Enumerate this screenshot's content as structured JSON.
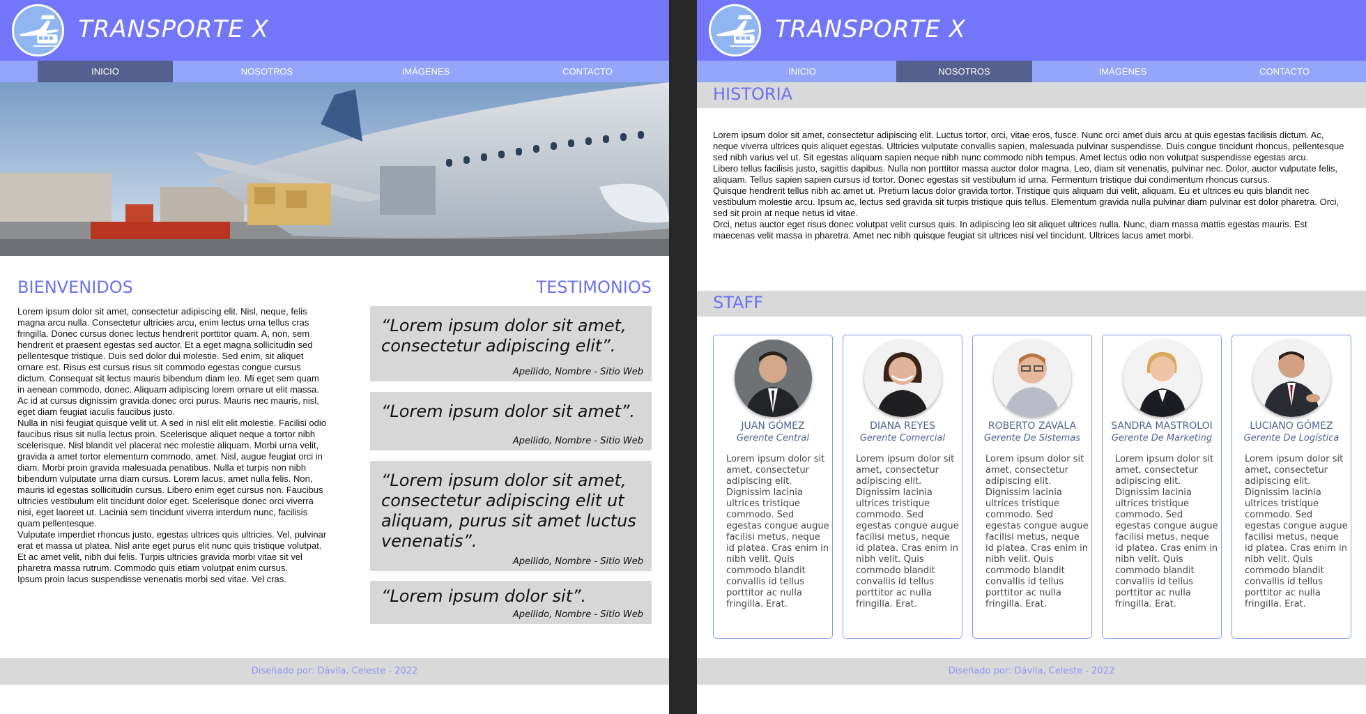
{
  "site": {
    "brand": "TRANSPORTE X"
  },
  "nav": {
    "items": [
      "INICIO",
      "NOSOTROS",
      "IMÁGENES",
      "CONTACTO"
    ]
  },
  "home": {
    "welcome_title": "BIENVENIDOS",
    "welcome_text": "Lorem ipsum dolor sit amet, consectetur adipiscing elit. Nisl, neque, felis magna arcu nulla. Consectetur ultricies arcu, enim lectus urna tellus cras fringilla. Donec cursus donec lectus hendrerit porttitor quam. A, non, sem hendrerit et praesent egestas sed auctor. Et a eget magna sollicitudin sed pellentesque tristique. Duis sed dolor dui molestie. Sed enim, sit aliquet ornare est. Risus est cursus risus sit commodo egestas congue cursus dictum. Consequat sit lectus mauris bibendum diam leo. Mi eget sem quam in aenean commodo, donec. Aliquam adipiscing lorem ornare ut elit massa. Ac id at cursus dignissim gravida donec orci purus. Mauris nec mauris, nisl, eget diam feugiat iaculis faucibus justo.\nNulla in nisi feugiat quisque velit ut. A sed in nisl elit elit molestie. Facilisi odio faucibus risus sit nulla lectus proin. Scelerisque aliquet neque a tortor nibh scelerisque. Nisl blandit vel placerat nec molestie aliquam. Morbi urna velit, gravida a amet tortor elementum commodo, amet. Nisl, augue feugiat orci in diam. Morbi proin gravida malesuada penatibus. Nulla et turpis non nibh bibendum vulputate urna diam cursus. Lorem lacus, amet nulla felis. Non, mauris id egestas sollicitudin cursus. Libero enim eget cursus non. Faucibus ultricies vestibulum elit tincidunt dolor eget. Scelerisque donec orci viverra nisi, eget laoreet ut. Lacinia sem tincidunt viverra interdum nunc, facilisis quam pellentesque.\nVulputate imperdiet rhoncus justo, egestas ultrices quis ultricies. Vel, pulvinar erat et massa ut platea. Nisl ante eget purus elit nunc quis tristique volutpat. Et ac amet velit, nibh dui felis. Turpis ultricies gravida morbi vitae sit vel pharetra massa rutrum. Commodo quis etiam volutpat enim cursus.\nIpsum proin lacus suspendisse venenatis morbi sed vitae. Vel cras.",
    "testimonials_title": "TESTIMONIOS",
    "testimonials": [
      {
        "quote": "“Lorem ipsum dolor sit amet, consectetur adipiscing elit”.",
        "author": "Apellido, Nombre - Sitio Web"
      },
      {
        "quote": "“Lorem ipsum dolor sit amet”.",
        "author": "Apellido, Nombre - Sitio Web"
      },
      {
        "quote": "“Lorem ipsum dolor sit amet, consectetur adipiscing elit ut aliquam, purus sit amet luctus venenatis”.",
        "author": "Apellido, Nombre - Sitio Web"
      },
      {
        "quote": "“Lorem ipsum dolor sit”.",
        "author": "Apellido, Nombre - Sitio Web"
      }
    ]
  },
  "about": {
    "history_title": "HISTORIA",
    "history_text": "Lorem ipsum dolor sit amet, consectetur adipiscing elit. Luctus tortor, orci, vitae eros, fusce. Nunc orci amet duis arcu at quis egestas facilisis dictum. Ac, neque viverra ultrices quis aliquet egestas. Ultricies vulputate convallis sapien, malesuada pulvinar suspendisse. Duis congue tincidunt rhoncus, pellentesque sed nibh varius vel ut. Sit egestas aliquam sapien neque nibh nunc commodo nibh tempus. Amet lectus odio non volutpat suspendisse egestas arcu.\nLibero tellus facilisis justo, sagittis dapibus. Nulla non porttitor massa auctor dolor magna. Leo, diam sit venenatis, pulvinar nec. Dolor, auctor vulputate felis, aliquam. Tellus sapien sapien cursus id tortor. Donec egestas sit vestibulum id urna. Fermentum tristique dui condimentum rhoncus cursus.\nQuisque hendrerit tellus nibh ac amet ut. Pretium lacus dolor gravida tortor. Tristique quis aliquam dui velit, aliquam. Eu et ultrices eu quis blandit nec vestibulum molestie arcu. Ipsum ac, lectus sed gravida sit turpis tristique quis tellus. Elementum gravida nulla pulvinar diam pulvinar est dolor pharetra. Orci, sed sit proin at neque netus id vitae.\nOrci, netus auctor eget risus donec volutpat velit cursus quis. In adipiscing leo sit aliquet ultrices nulla. Nunc, diam massa mattis egestas mauris. Est maecenas velit massa in pharetra. Amet nec nibh quisque feugiat sit ultrices nisi vel tincidunt. Ultrices lacus amet morbi.",
    "staff_title": "STAFF",
    "staff": [
      {
        "name": "JUAN GÓMEZ",
        "role": "Gerente Central"
      },
      {
        "name": "DIANA REYES",
        "role": "Gerente Comercial"
      },
      {
        "name": "ROBERTO ZAVALA",
        "role": "Gerente De Sistemas"
      },
      {
        "name": "SANDRA MASTROLOI",
        "role": "Gerente De Marketing"
      },
      {
        "name": "LUCIANO GÓMEZ",
        "role": "Gerente De Logística"
      }
    ],
    "staff_bio": "Lorem ipsum dolor sit amet, consectetur adipiscing elit. Dignissim lacinia ultrices tristique commodo. Sed egestas congue augue facilisi metus, neque id platea. Cras enim in nibh velit. Quis commodo blandit convallis id tellus porttitor ac nulla fringilla. Erat."
  },
  "footer": {
    "credit": "Diseñado por: Dávila, Celeste - 2022"
  }
}
